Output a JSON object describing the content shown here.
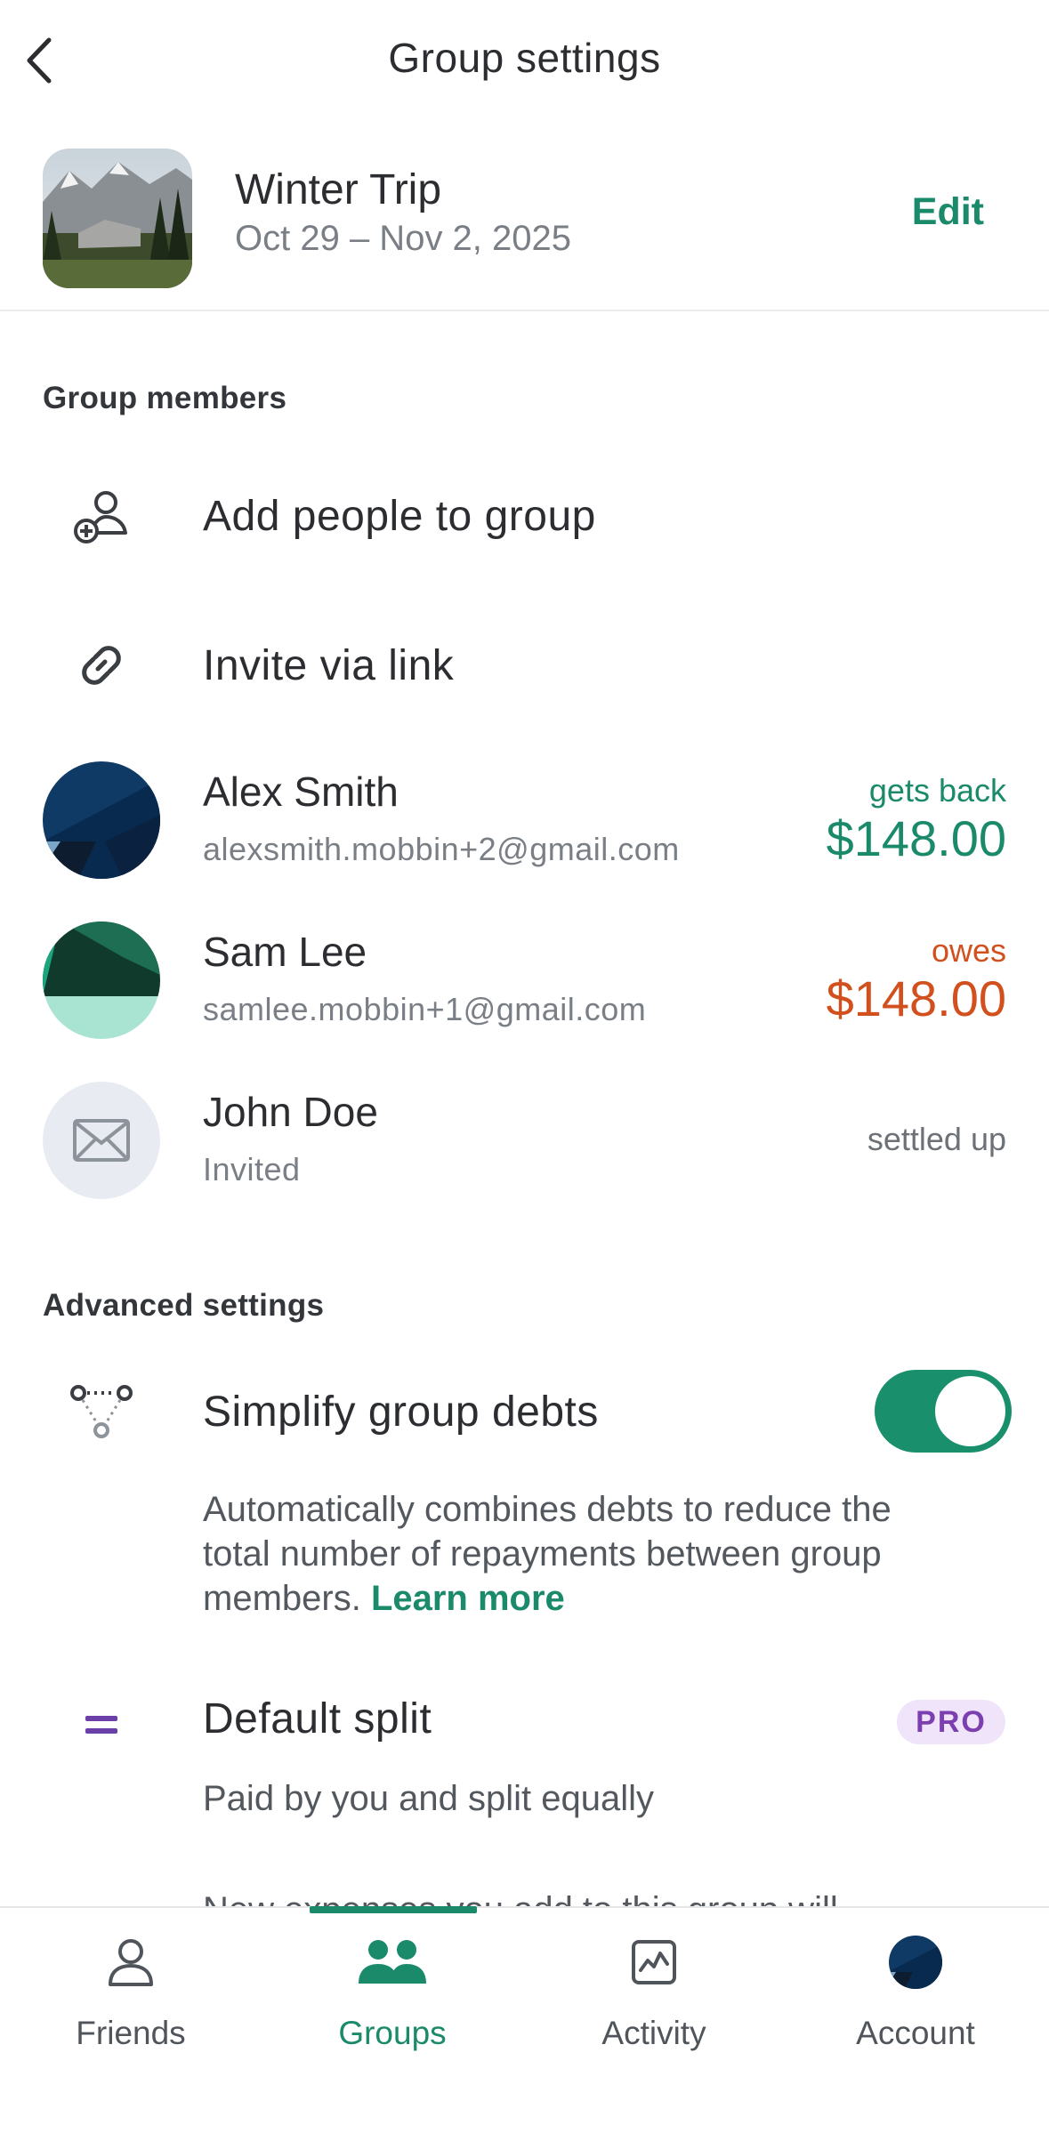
{
  "header": {
    "title": "Group settings",
    "back_icon": "chevron-left-icon"
  },
  "group": {
    "name": "Winter Trip",
    "dates": "Oct 29 – Nov 2, 2025",
    "edit_label": "Edit"
  },
  "members_section": {
    "title": "Group members",
    "add_people_label": "Add people to group",
    "invite_link_label": "Invite via link",
    "members": [
      {
        "name": "Alex Smith",
        "sub": "alexsmith.mobbin+2@gmail.com",
        "status": "gets back",
        "amount": "$148.00"
      },
      {
        "name": "Sam Lee",
        "sub": "samlee.mobbin+1@gmail.com",
        "status": "owes",
        "amount": "$148.00"
      },
      {
        "name": "John Doe",
        "sub": "Invited",
        "status": "settled up"
      }
    ]
  },
  "advanced_section": {
    "title": "Advanced settings",
    "simplify_label": "Simplify group debts",
    "simplify_enabled": true,
    "simplify_desc": "Automatically combines debts to reduce the total number of repayments between group members.",
    "learn_more": "Learn more",
    "default_split_label": "Default split",
    "pro_badge": "PRO",
    "default_split_desc": "Paid by you and split equally",
    "cut_off_text": "New expenses you add to this group will"
  },
  "tabbar": {
    "tabs": [
      {
        "label": "Friends",
        "icon": "person-icon"
      },
      {
        "label": "Groups",
        "icon": "group-icon",
        "active": true
      },
      {
        "label": "Activity",
        "icon": "activity-icon"
      },
      {
        "label": "Account",
        "icon": "account-avatar"
      }
    ]
  },
  "colors": {
    "accent": "#1b8a6b",
    "owes": "#d2501d",
    "pro": "#7b3fb0"
  }
}
